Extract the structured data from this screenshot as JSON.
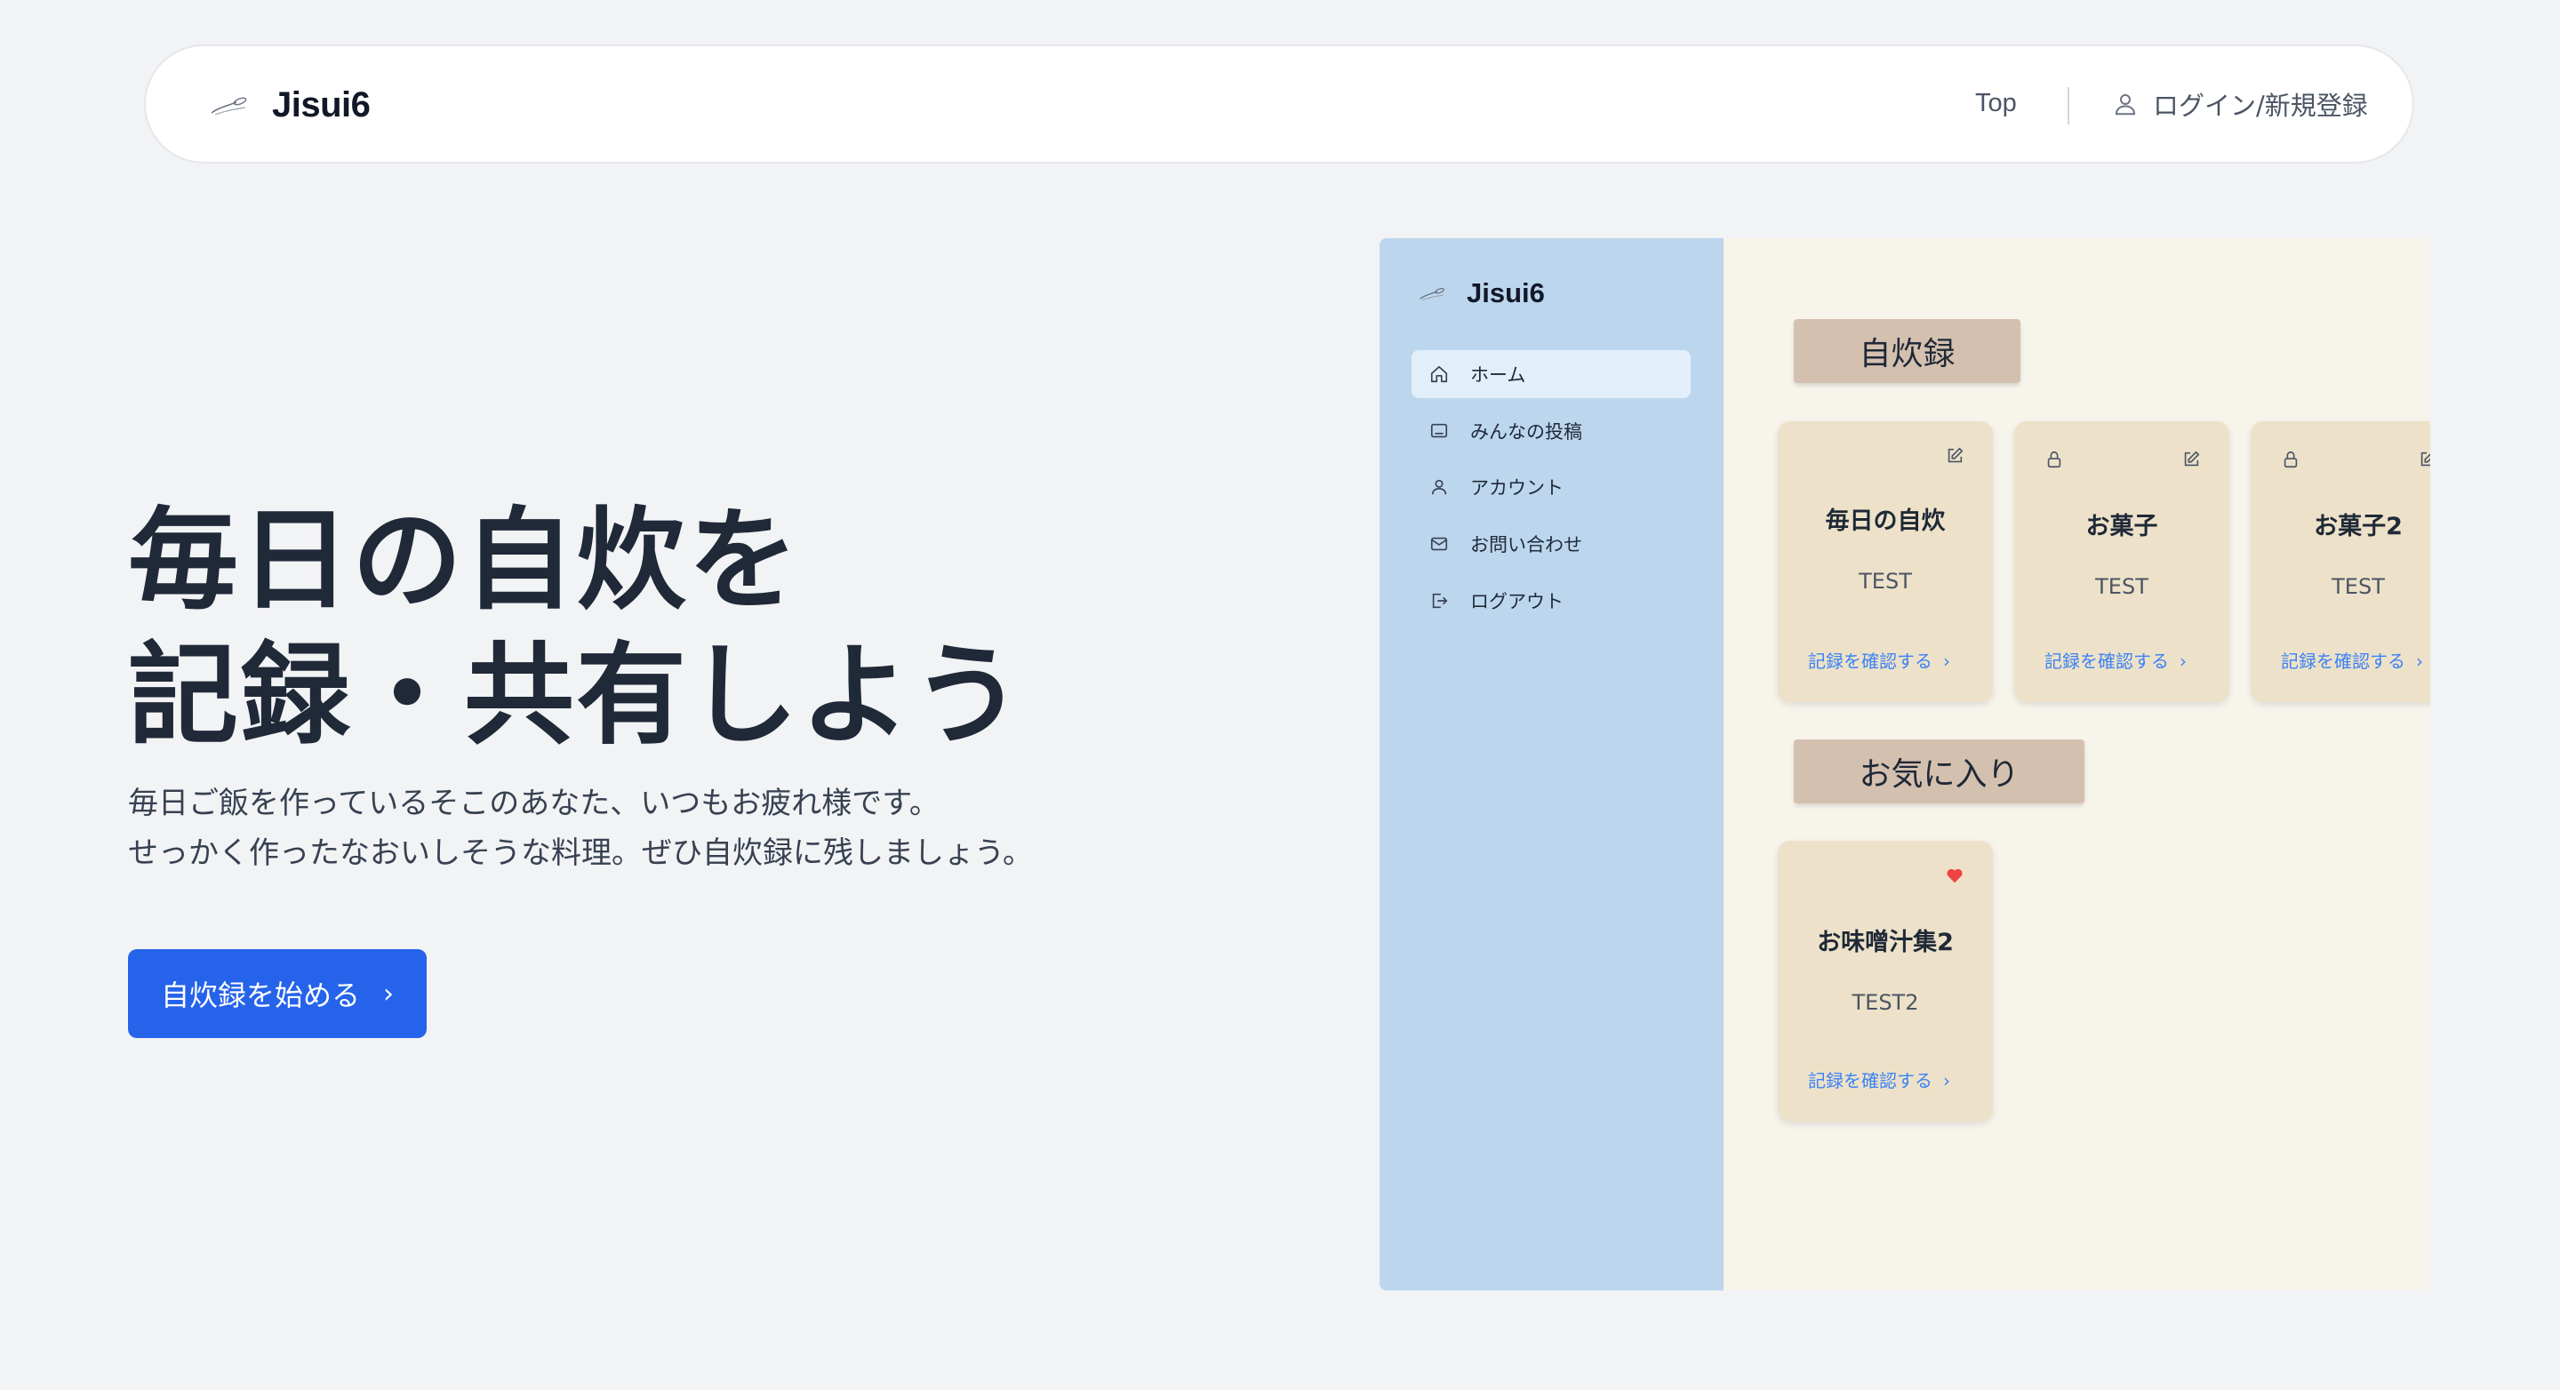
{
  "header": {
    "brand": "Jisui6",
    "nav_top": "Top",
    "nav_login": "ログイン/新規登録"
  },
  "hero": {
    "title_line1": "毎日の自炊を",
    "title_line2": "記録・共有しよう",
    "desc_line1": "毎日ご飯を作っているそこのあなた、いつもお疲れ様です。",
    "desc_line2": "せっかく作ったなおいしそうな料理。ぜひ自炊録に残しましょう。",
    "cta_label": "自炊録を始める",
    "cta_color": "#2563eb"
  },
  "mock": {
    "brand": "Jisui6",
    "sidebar_items": [
      {
        "label": "ホーム",
        "icon": "home-icon",
        "active": true
      },
      {
        "label": "みんなの投稿",
        "icon": "image-icon",
        "active": false
      },
      {
        "label": "アカウント",
        "icon": "user-icon",
        "active": false
      },
      {
        "label": "お問い合わせ",
        "icon": "mail-icon",
        "active": false
      },
      {
        "label": "ログアウト",
        "icon": "logout-icon",
        "active": false
      }
    ],
    "sections": {
      "records": "自炊録",
      "favorites": "お気に入り"
    },
    "record_cards": [
      {
        "title": "毎日の自炊",
        "desc": "TEST",
        "link": "記録を確認する",
        "locked": false
      },
      {
        "title": "お菓子",
        "desc": "TEST",
        "link": "記録を確認する",
        "locked": true
      },
      {
        "title": "お菓子2",
        "desc": "TEST",
        "link": "記録を確認する",
        "locked": true
      }
    ],
    "favorite_cards": [
      {
        "title": "お味噌汁集2",
        "desc": "TEST2",
        "link": "記録を確認する",
        "favorite": true
      }
    ],
    "colors": {
      "sidebar": "#bcd6ee",
      "sidebar_active": "#e2effb",
      "main_bg": "#f7f4ec",
      "card": "#ede2c9",
      "section_label": "#d4c0af",
      "link": "#3b82f6",
      "heart": "#ef4444"
    }
  }
}
